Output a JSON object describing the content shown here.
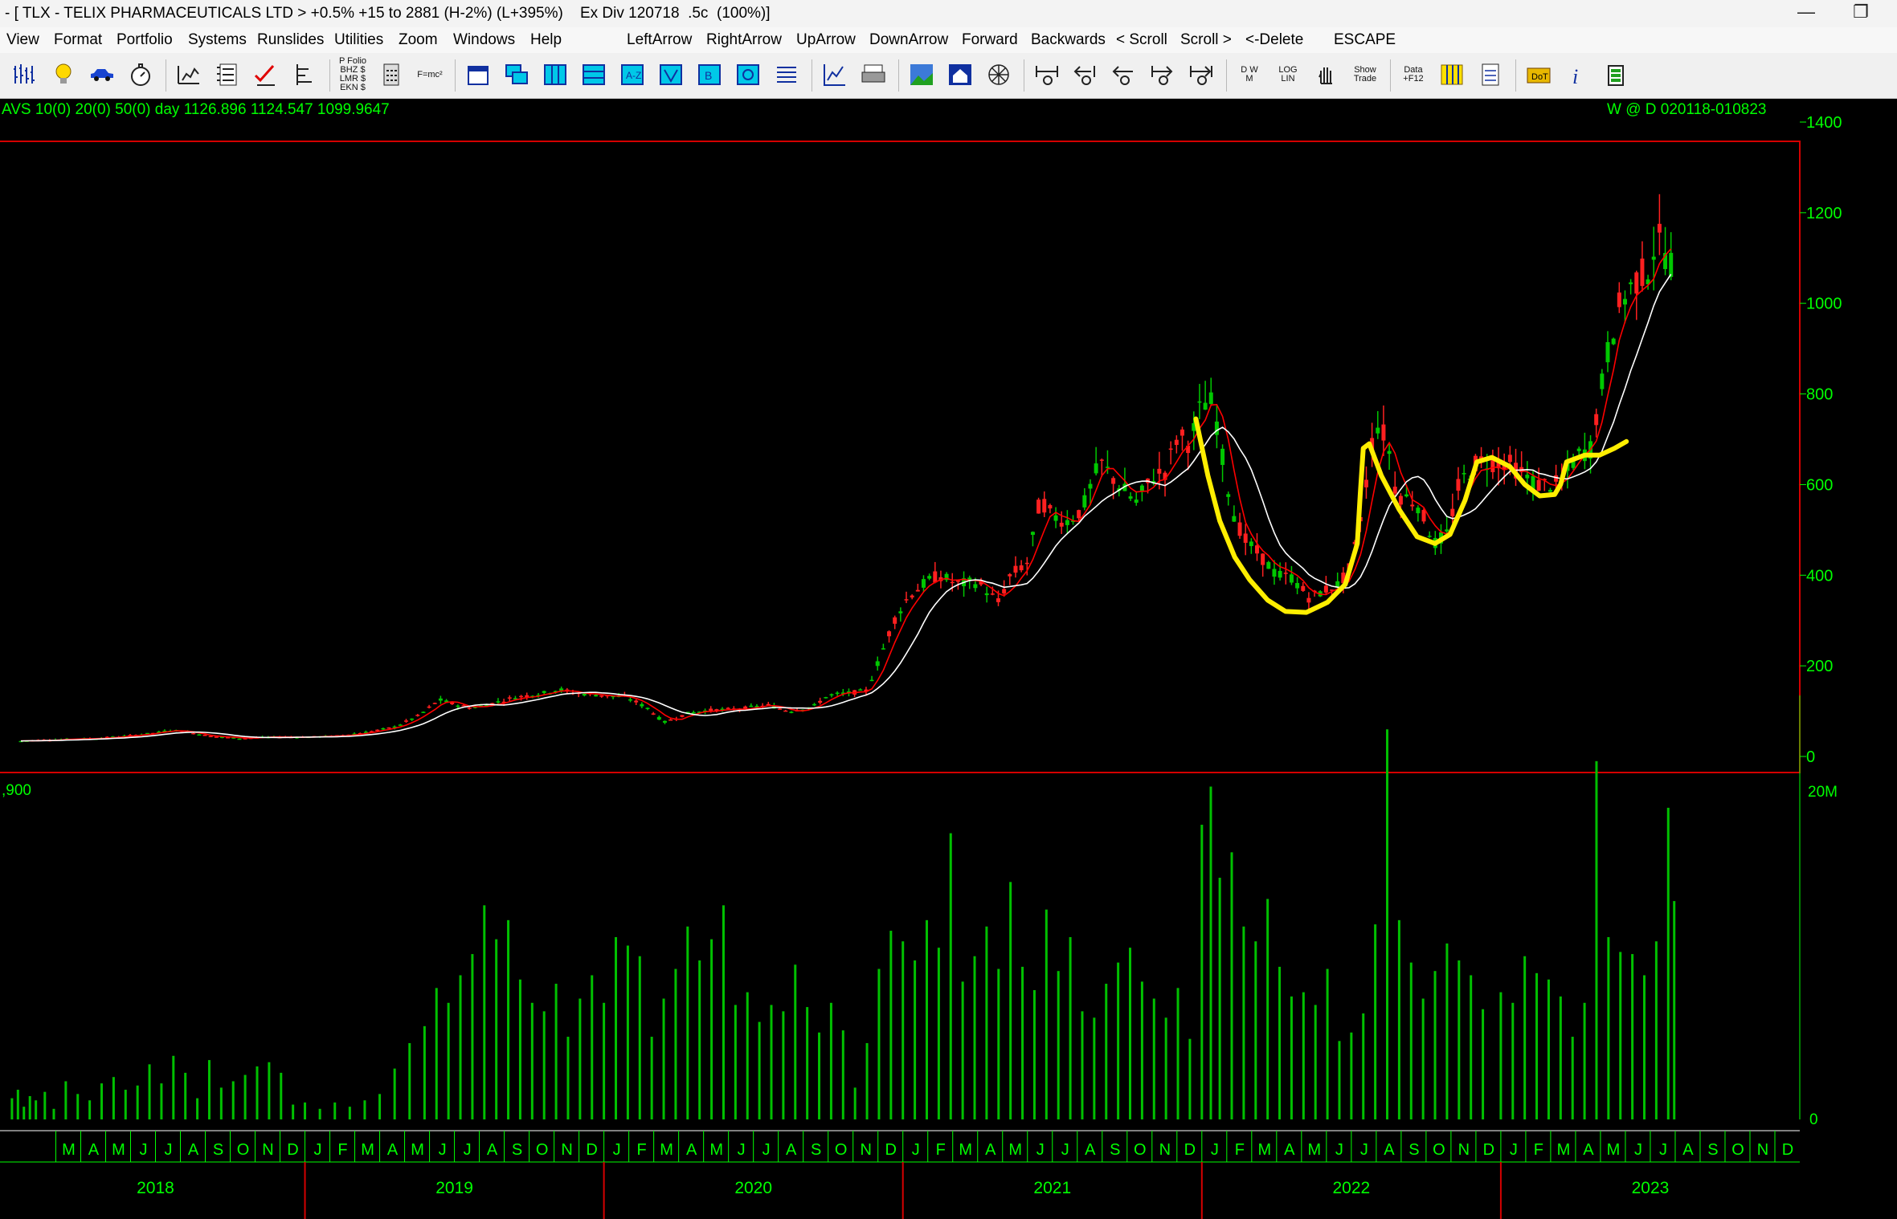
{
  "window": {
    "title": "- [ TLX - TELIX PHARMACEUTICALS LTD > +0.5% +15 to 2881 (H-2%) (L+395%)    Ex Div 120718  .5c  (100%)]",
    "minimize_glyph": "—",
    "restore_glyph": "❐"
  },
  "menu": {
    "items": [
      "View",
      "Format",
      "Portfolio",
      "Systems",
      "Runslides",
      "Utilities",
      "Zoom",
      "Windows",
      "Help",
      "LeftArrow",
      "RightArrow",
      "UpArrow",
      "DownArrow",
      "Forward",
      "Backwards",
      "< Scroll",
      "Scroll >",
      "<-Delete",
      "ESCAPE"
    ]
  },
  "toolbar": {
    "icon_names": [
      "weekly-bars-icon",
      "lightbulb-icon",
      "car-icon",
      "stopwatch-icon",
      "weekly-chart-icon",
      "tick-table-icon",
      "red-tick-icon",
      "sidebar-chart-icon",
      "portfolio-icon",
      "calculator-icon",
      "formula-icon",
      "calendar-icon",
      "overlap-icon",
      "columns-icon",
      "rows-icon",
      "atoz-icon",
      "triangle-icon",
      "b-box-icon",
      "spiral-icon",
      "list-icon",
      "line-chart-icon",
      "printer-icon",
      "landscape-icon",
      "house-icon",
      "spider-icon",
      "zoom-out-all-icon",
      "zoom-out-left-icon",
      "zoom-out-icon",
      "zoom-in-icon",
      "zoom-in-right-icon",
      "dwm-icon",
      "log-lin-icon",
      "hand-icon",
      "show-trade-icon",
      "data-f12-icon",
      "data-grid-icon",
      "notepad-icon",
      "dot-folder-icon",
      "info-icon",
      "battery-icon"
    ],
    "text_icons": {
      "portfolio": [
        "P Folio",
        "BHZ $",
        "LMR $",
        "EKN $"
      ],
      "formula": "F=mc²",
      "dwm": [
        "D",
        "W",
        "M"
      ],
      "loglin": [
        "LOG",
        "LIN"
      ],
      "showtrade": [
        "Show",
        "Trade"
      ],
      "data": [
        "Data",
        "+F12"
      ],
      "dot": "DoT"
    }
  },
  "chart_data": {
    "type": "candlestick",
    "header_left": "AVS 10(0) 20(0) 50(0)  day     1126.896  1124.547  1099.9647",
    "header_right": "W @ D   020118-010823",
    "price_axis": {
      "ticks": [
        0,
        200,
        400,
        600,
        800,
        1000,
        1200,
        1400
      ],
      "labels": [
        "0",
        "200",
        "400",
        "600",
        "800",
        "1000",
        "1200",
        "1400"
      ],
      "ylim": [
        0,
        1400
      ]
    },
    "volume_axis": {
      "top_label": "20M",
      "zero_label": "0",
      "ylim": [
        0,
        20000000
      ],
      "left_label": ",900"
    },
    "colors": {
      "up": "#00c800",
      "down": "#ff2020",
      "grid": "#ffffff",
      "border": "#d40000",
      "axis_text": "#00ff00",
      "ma_fast": "#ff0000",
      "ma_slow": "#ffffff",
      "volume": "#00c000",
      "annotation": "#ffee00"
    },
    "moving_average_periods": [
      10,
      50
    ],
    "price_series": [
      [
        2018.05,
        34
      ],
      [
        2018.1,
        36
      ],
      [
        2018.15,
        37
      ],
      [
        2018.2,
        38
      ],
      [
        2018.3,
        40
      ],
      [
        2018.4,
        45
      ],
      [
        2018.5,
        52
      ],
      [
        2018.55,
        58
      ],
      [
        2018.6,
        55
      ],
      [
        2018.68,
        45
      ],
      [
        2018.78,
        40
      ],
      [
        2018.85,
        42
      ],
      [
        2018.92,
        43
      ],
      [
        2019.0,
        43
      ],
      [
        2019.1,
        45
      ],
      [
        2019.2,
        53
      ],
      [
        2019.3,
        65
      ],
      [
        2019.38,
        90
      ],
      [
        2019.45,
        125
      ],
      [
        2019.5,
        115
      ],
      [
        2019.55,
        108
      ],
      [
        2019.6,
        112
      ],
      [
        2019.7,
        130
      ],
      [
        2019.8,
        140
      ],
      [
        2019.85,
        148
      ],
      [
        2019.9,
        140
      ],
      [
        2020.0,
        135
      ],
      [
        2020.08,
        130
      ],
      [
        2020.15,
        105
      ],
      [
        2020.2,
        75
      ],
      [
        2020.28,
        95
      ],
      [
        2020.35,
        102
      ],
      [
        2020.45,
        105
      ],
      [
        2020.55,
        113
      ],
      [
        2020.62,
        100
      ],
      [
        2020.7,
        110
      ],
      [
        2020.75,
        135
      ],
      [
        2020.82,
        140
      ],
      [
        2020.88,
        145
      ],
      [
        2020.93,
        230
      ],
      [
        2020.97,
        300
      ],
      [
        2021.02,
        355
      ],
      [
        2021.08,
        385
      ],
      [
        2021.12,
        400
      ],
      [
        2021.18,
        380
      ],
      [
        2021.25,
        385
      ],
      [
        2021.32,
        340
      ],
      [
        2021.36,
        400
      ],
      [
        2021.42,
        430
      ],
      [
        2021.46,
        570
      ],
      [
        2021.5,
        530
      ],
      [
        2021.55,
        520
      ],
      [
        2021.6,
        545
      ],
      [
        2021.66,
        650
      ],
      [
        2021.72,
        600
      ],
      [
        2021.78,
        560
      ],
      [
        2021.84,
        620
      ],
      [
        2021.88,
        630
      ],
      [
        2021.92,
        710
      ],
      [
        2021.96,
        690
      ],
      [
        2022.0,
        780
      ],
      [
        2022.04,
        780
      ],
      [
        2022.06,
        690
      ],
      [
        2022.1,
        550
      ],
      [
        2022.14,
        480
      ],
      [
        2022.2,
        440
      ],
      [
        2022.25,
        400
      ],
      [
        2022.3,
        395
      ],
      [
        2022.36,
        350
      ],
      [
        2022.42,
        370
      ],
      [
        2022.46,
        380
      ],
      [
        2022.5,
        420
      ],
      [
        2022.54,
        560
      ],
      [
        2022.58,
        740
      ],
      [
        2022.62,
        700
      ],
      [
        2022.65,
        580
      ],
      [
        2022.72,
        560
      ],
      [
        2022.78,
        470
      ],
      [
        2022.82,
        490
      ],
      [
        2022.86,
        600
      ],
      [
        2022.92,
        650
      ],
      [
        2022.97,
        650
      ],
      [
        2023.02,
        650
      ],
      [
        2023.08,
        620
      ],
      [
        2023.12,
        600
      ],
      [
        2023.16,
        600
      ],
      [
        2023.2,
        600
      ],
      [
        2023.25,
        660
      ],
      [
        2023.3,
        680
      ],
      [
        2023.36,
        900
      ],
      [
        2023.4,
        1000
      ],
      [
        2023.45,
        1050
      ],
      [
        2023.5,
        1080
      ],
      [
        2023.52,
        1150
      ],
      [
        2023.56,
        1100
      ],
      [
        2023.58,
        1080
      ]
    ],
    "volume_series": [
      [
        2018.02,
        1.0
      ],
      [
        2018.04,
        1.4
      ],
      [
        2018.06,
        0.6
      ],
      [
        2018.08,
        1.1
      ],
      [
        2018.1,
        0.9
      ],
      [
        2018.13,
        1.3
      ],
      [
        2018.16,
        0.5
      ],
      [
        2018.2,
        1.8
      ],
      [
        2018.24,
        1.2
      ],
      [
        2018.28,
        0.9
      ],
      [
        2018.32,
        1.7
      ],
      [
        2018.36,
        2.0
      ],
      [
        2018.4,
        1.4
      ],
      [
        2018.44,
        1.6
      ],
      [
        2018.48,
        2.6
      ],
      [
        2018.52,
        1.7
      ],
      [
        2018.56,
        3.0
      ],
      [
        2018.6,
        2.2
      ],
      [
        2018.64,
        1.0
      ],
      [
        2018.68,
        2.8
      ],
      [
        2018.72,
        1.5
      ],
      [
        2018.76,
        1.8
      ],
      [
        2018.8,
        2.1
      ],
      [
        2018.84,
        2.5
      ],
      [
        2018.88,
        2.7
      ],
      [
        2018.92,
        2.2
      ],
      [
        2018.96,
        0.7
      ],
      [
        2019.0,
        0.8
      ],
      [
        2019.05,
        0.5
      ],
      [
        2019.1,
        0.8
      ],
      [
        2019.15,
        0.6
      ],
      [
        2019.2,
        0.9
      ],
      [
        2019.25,
        1.2
      ],
      [
        2019.3,
        2.4
      ],
      [
        2019.35,
        3.6
      ],
      [
        2019.4,
        4.4
      ],
      [
        2019.44,
        6.2
      ],
      [
        2019.48,
        5.5
      ],
      [
        2019.52,
        6.8
      ],
      [
        2019.56,
        7.8
      ],
      [
        2019.6,
        10.1
      ],
      [
        2019.64,
        8.5
      ],
      [
        2019.68,
        9.4
      ],
      [
        2019.72,
        6.6
      ],
      [
        2019.76,
        5.5
      ],
      [
        2019.8,
        5.1
      ],
      [
        2019.84,
        6.4
      ],
      [
        2019.88,
        3.9
      ],
      [
        2019.92,
        5.7
      ],
      [
        2019.96,
        6.8
      ],
      [
        2020.0,
        5.5
      ],
      [
        2020.04,
        8.6
      ],
      [
        2020.08,
        8.2
      ],
      [
        2020.12,
        7.7
      ],
      [
        2020.16,
        3.9
      ],
      [
        2020.2,
        5.7
      ],
      [
        2020.24,
        7.1
      ],
      [
        2020.28,
        9.1
      ],
      [
        2020.32,
        7.5
      ],
      [
        2020.36,
        8.5
      ],
      [
        2020.4,
        10.1
      ],
      [
        2020.44,
        5.4
      ],
      [
        2020.48,
        6.0
      ],
      [
        2020.52,
        4.6
      ],
      [
        2020.56,
        5.4
      ],
      [
        2020.6,
        5.1
      ],
      [
        2020.64,
        7.3
      ],
      [
        2020.68,
        5.3
      ],
      [
        2020.72,
        4.1
      ],
      [
        2020.76,
        5.5
      ],
      [
        2020.8,
        4.2
      ],
      [
        2020.84,
        1.5
      ],
      [
        2020.88,
        3.6
      ],
      [
        2020.92,
        7.1
      ],
      [
        2020.96,
        8.9
      ],
      [
        2021.0,
        8.4
      ],
      [
        2021.04,
        7.5
      ],
      [
        2021.08,
        9.4
      ],
      [
        2021.12,
        8.1
      ],
      [
        2021.16,
        13.5
      ],
      [
        2021.2,
        6.5
      ],
      [
        2021.24,
        7.7
      ],
      [
        2021.28,
        9.1
      ],
      [
        2021.32,
        7.1
      ],
      [
        2021.36,
        11.2
      ],
      [
        2021.4,
        7.2
      ],
      [
        2021.44,
        6.1
      ],
      [
        2021.48,
        9.9
      ],
      [
        2021.52,
        7.0
      ],
      [
        2021.56,
        8.6
      ],
      [
        2021.6,
        5.1
      ],
      [
        2021.64,
        4.8
      ],
      [
        2021.68,
        6.4
      ],
      [
        2021.72,
        7.4
      ],
      [
        2021.76,
        8.1
      ],
      [
        2021.8,
        6.5
      ],
      [
        2021.84,
        5.7
      ],
      [
        2021.88,
        4.8
      ],
      [
        2021.92,
        6.2
      ],
      [
        2021.96,
        3.8
      ],
      [
        2022.0,
        13.9
      ],
      [
        2022.03,
        15.7
      ],
      [
        2022.06,
        11.4
      ],
      [
        2022.1,
        12.6
      ],
      [
        2022.14,
        9.1
      ],
      [
        2022.18,
        8.4
      ],
      [
        2022.22,
        10.4
      ],
      [
        2022.26,
        7.2
      ],
      [
        2022.3,
        5.8
      ],
      [
        2022.34,
        6.0
      ],
      [
        2022.38,
        5.4
      ],
      [
        2022.42,
        7.1
      ],
      [
        2022.46,
        3.7
      ],
      [
        2022.5,
        4.1
      ],
      [
        2022.54,
        5.0
      ],
      [
        2022.58,
        9.2
      ],
      [
        2022.62,
        18.4
      ],
      [
        2022.66,
        9.4
      ],
      [
        2022.7,
        7.4
      ],
      [
        2022.74,
        5.7
      ],
      [
        2022.78,
        7.0
      ],
      [
        2022.82,
        8.3
      ],
      [
        2022.86,
        7.5
      ],
      [
        2022.9,
        6.8
      ],
      [
        2022.94,
        5.2
      ],
      [
        2023.0,
        6.0
      ],
      [
        2023.04,
        5.5
      ],
      [
        2023.08,
        7.7
      ],
      [
        2023.12,
        6.9
      ],
      [
        2023.16,
        6.6
      ],
      [
        2023.2,
        5.8
      ],
      [
        2023.24,
        3.9
      ],
      [
        2023.28,
        5.5
      ],
      [
        2023.32,
        16.9
      ],
      [
        2023.36,
        8.6
      ],
      [
        2023.4,
        7.9
      ],
      [
        2023.44,
        7.8
      ],
      [
        2023.48,
        6.8
      ],
      [
        2023.52,
        8.4
      ],
      [
        2023.56,
        14.7
      ],
      [
        2023.58,
        10.3
      ]
    ],
    "annotation_path": [
      [
        2021.98,
        745
      ],
      [
        2022.02,
        620
      ],
      [
        2022.06,
        520
      ],
      [
        2022.11,
        440
      ],
      [
        2022.16,
        390
      ],
      [
        2022.22,
        345
      ],
      [
        2022.28,
        320
      ],
      [
        2022.35,
        318
      ],
      [
        2022.42,
        340
      ],
      [
        2022.48,
        380
      ],
      [
        2022.52,
        470
      ],
      [
        2022.53,
        580
      ],
      [
        2022.54,
        680
      ],
      [
        2022.56,
        690
      ],
      [
        2022.6,
        620
      ],
      [
        2022.66,
        545
      ],
      [
        2022.72,
        485
      ],
      [
        2022.78,
        470
      ],
      [
        2022.83,
        490
      ],
      [
        2022.88,
        565
      ],
      [
        2022.92,
        650
      ],
      [
        2022.97,
        660
      ],
      [
        2023.03,
        640
      ],
      [
        2023.08,
        600
      ],
      [
        2023.13,
        575
      ],
      [
        2023.18,
        578
      ],
      [
        2023.2,
        600
      ],
      [
        2023.22,
        650
      ],
      [
        2023.28,
        665
      ],
      [
        2023.33,
        665
      ],
      [
        2023.38,
        680
      ],
      [
        2023.42,
        695
      ]
    ],
    "time_axis": {
      "start": 2018.0,
      "end": 2024.0,
      "month_labels": [
        "J",
        "F",
        "M",
        "A",
        "M",
        "J",
        "J",
        "A",
        "S",
        "O",
        "N",
        "D"
      ],
      "year_labels": [
        "2018",
        "2019",
        "2020",
        "2021",
        "2022",
        "2023"
      ]
    }
  }
}
